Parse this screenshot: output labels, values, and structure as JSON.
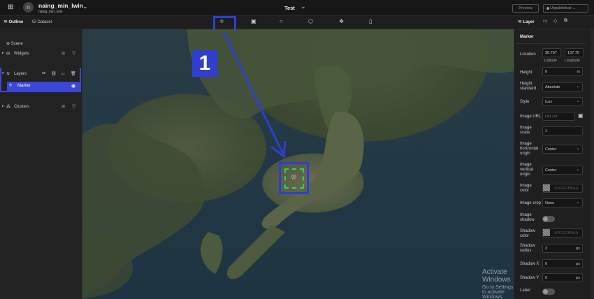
{
  "topbar": {
    "workspace_initial": "n",
    "username": "naing_min_lwin",
    "sub_username": "naing_min_lwin",
    "project_title": "Test",
    "preview_label": "Preview",
    "status_label": "Unpublished"
  },
  "left_tabs": {
    "outline": "Outline",
    "dataset": "Dataset"
  },
  "left_panel": {
    "scene": "Scene",
    "widgets": "Widgets",
    "layers": "Layers",
    "marker": "Marker",
    "clusters": "Clusters"
  },
  "map": {
    "annotation_number": "1"
  },
  "watermark": {
    "title": "Activate Windows",
    "subtitle": "Go to Settings to activate Windows."
  },
  "right_panel": {
    "tab_label": "Layer",
    "section_title": "Marker",
    "location_label": "Location",
    "latitude_value": "36.797",
    "longitude_value": "137.70",
    "latitude_label": "Latitude",
    "longitude_label": "Longitude",
    "height_label": "Height",
    "height_value": "0",
    "height_unit": "m",
    "height_standard_label": "Height standard",
    "height_standard_value": "Absolute",
    "style_label": "Style",
    "style_value": "Icon",
    "image_url_label": "Image URL",
    "image_url_placeholder": "Not set",
    "image_scale_label": "Image scale",
    "image_scale_value": "1",
    "horizontal_origin_label": "Image horizontal origin",
    "horizontal_origin_value": "Center",
    "vertical_origin_label": "Image vertical origin",
    "vertical_origin_value": "Center",
    "image_color_label": "Image color",
    "image_color_value": "#RRGGBBAA",
    "image_crop_label": "Image crop",
    "image_crop_value": "None",
    "image_shadow_label": "Image shadow",
    "shadow_color_label": "Shadow color",
    "shadow_color_value": "#RRGGBBAA",
    "shadow_radius_label": "Shadow radius",
    "shadow_radius_value": "3",
    "shadow_radius_unit": "px",
    "shadow_x_label": "Shadow X",
    "shadow_x_value": "0",
    "shadow_x_unit": "px",
    "shadow_y_label": "Shadow Y",
    "shadow_y_value": "0",
    "shadow_y_unit": "px",
    "label_label": "Label"
  },
  "colors": {
    "accent": "#3b47d6",
    "annotation": "#2f3fd0",
    "selection_green": "#3dd13d"
  }
}
